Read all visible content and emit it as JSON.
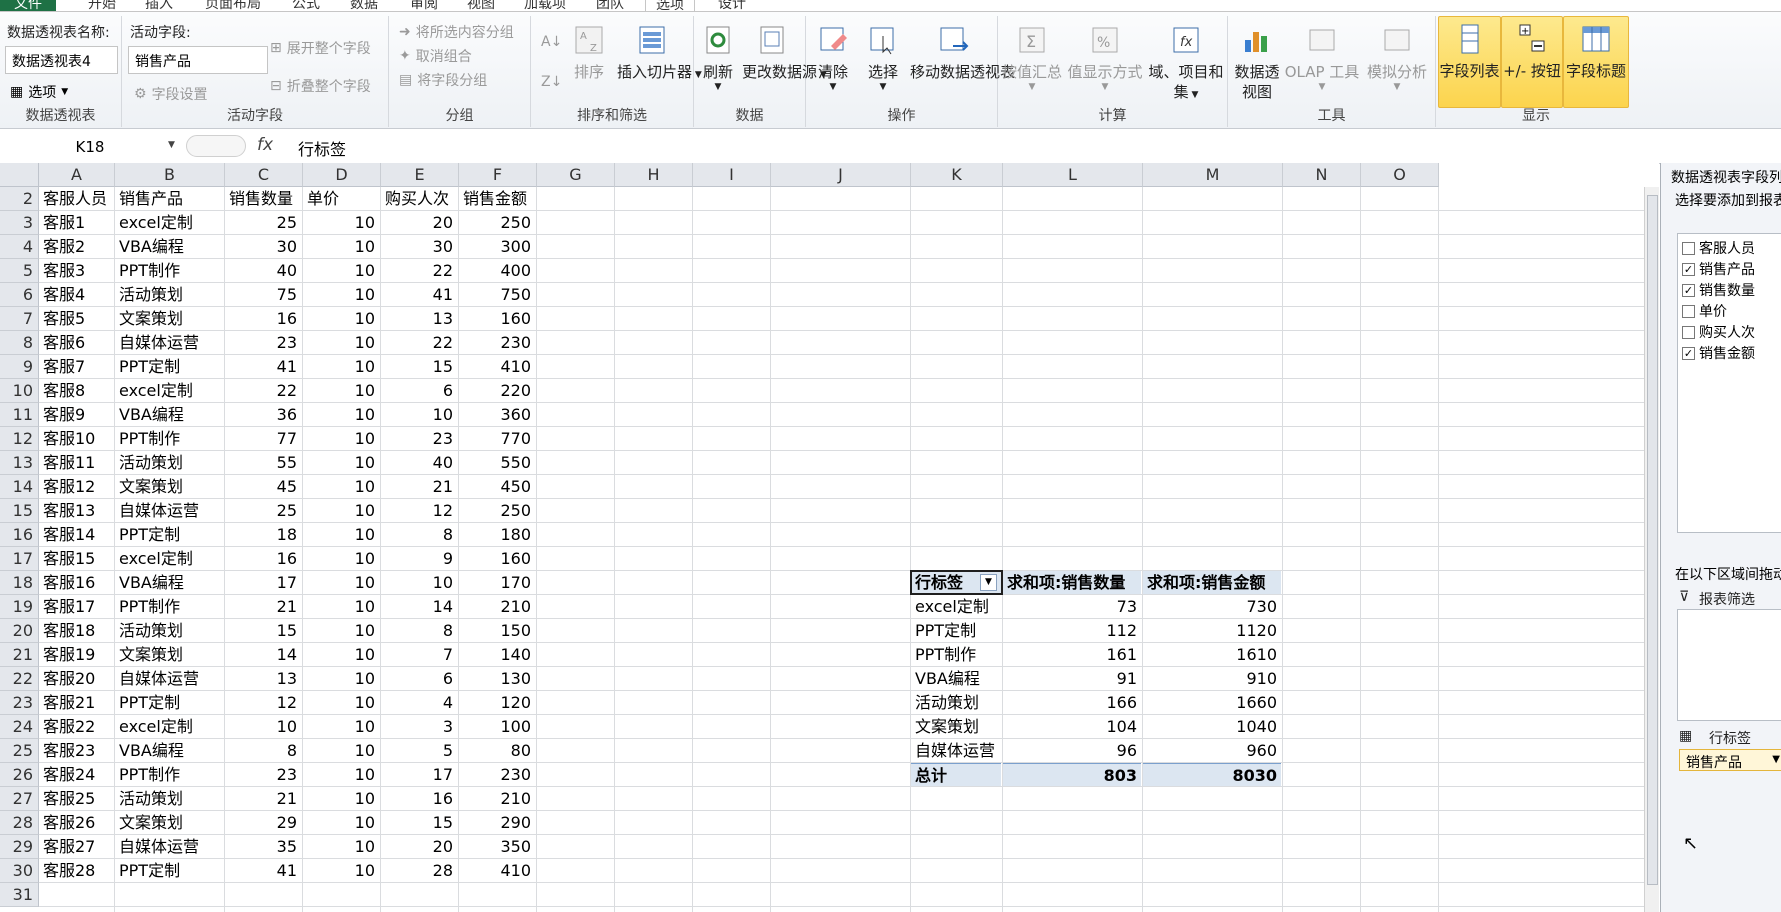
{
  "ribbon_tabs": [
    "文件",
    "开始",
    "插入",
    "页面布局",
    "公式",
    "数据",
    "审阅",
    "视图",
    "加载项",
    "团队",
    "选项",
    "设计"
  ],
  "ribbon": {
    "pivot_name_label": "数据透视表名称:",
    "pivot_name_value": "数据透视表4",
    "options_label": "选项",
    "group_pivot": "数据透视表",
    "active_field_label": "活动字段:",
    "active_field_value": "销售产品",
    "field_settings": "字段设置",
    "expand_field": "展开整个字段",
    "collapse_field": "折叠整个字段",
    "group_active_field": "活动字段",
    "group_selection": "将所选内容分组",
    "ungroup": "取消组合",
    "group_field": "将字段分组",
    "group_group": "分组",
    "sort": "排序",
    "insert_slicer": "插入切片器",
    "group_sort": "排序和筛选",
    "refresh": "刷新",
    "change_source": "更改数据源",
    "group_data": "数据",
    "clear": "清除",
    "select": "选择",
    "move_pivot": "移动数据透视表",
    "group_actions": "操作",
    "summarize_by": "按值汇总",
    "show_values_as": "值显示方式",
    "fields_items_sets": "域、项目和集",
    "group_calc": "计算",
    "pivot_chart": "数据透视图",
    "olap_tools": "OLAP 工具",
    "what_if": "模拟分析",
    "group_tools": "工具",
    "field_list": "字段列表",
    "plus_minus_buttons": "+/- 按钮",
    "field_headers": "字段标题",
    "group_show": "显示"
  },
  "formula_bar": {
    "name_box": "K18",
    "fx": "fx",
    "formula": "行标签"
  },
  "sheet": {
    "columns": [
      "A",
      "B",
      "C",
      "D",
      "E",
      "F",
      "G",
      "H",
      "I",
      "J",
      "K",
      "L",
      "M",
      "N",
      "O"
    ],
    "row_numbers": [
      "2",
      "3",
      "4",
      "5",
      "6",
      "7",
      "8",
      "9",
      "10",
      "11",
      "12",
      "13",
      "14",
      "15",
      "16",
      "17",
      "18",
      "19",
      "20",
      "21",
      "22",
      "23",
      "24",
      "25",
      "26",
      "27",
      "28",
      "29",
      "30",
      "31"
    ],
    "headers": [
      "客服人员",
      "销售产品",
      "销售数量",
      "单价",
      "购买人次",
      "销售金额"
    ],
    "rows": [
      [
        "客服1",
        "excel定制",
        "25",
        "10",
        "20",
        "250"
      ],
      [
        "客服2",
        "VBA编程",
        "30",
        "10",
        "30",
        "300"
      ],
      [
        "客服3",
        "PPT制作",
        "40",
        "10",
        "22",
        "400"
      ],
      [
        "客服4",
        "活动策划",
        "75",
        "10",
        "41",
        "750"
      ],
      [
        "客服5",
        "文案策划",
        "16",
        "10",
        "13",
        "160"
      ],
      [
        "客服6",
        "自媒体运营",
        "23",
        "10",
        "22",
        "230"
      ],
      [
        "客服7",
        "PPT定制",
        "41",
        "10",
        "15",
        "410"
      ],
      [
        "客服8",
        "excel定制",
        "22",
        "10",
        "6",
        "220"
      ],
      [
        "客服9",
        "VBA编程",
        "36",
        "10",
        "10",
        "360"
      ],
      [
        "客服10",
        "PPT制作",
        "77",
        "10",
        "23",
        "770"
      ],
      [
        "客服11",
        "活动策划",
        "55",
        "10",
        "40",
        "550"
      ],
      [
        "客服12",
        "文案策划",
        "45",
        "10",
        "21",
        "450"
      ],
      [
        "客服13",
        "自媒体运营",
        "25",
        "10",
        "12",
        "250"
      ],
      [
        "客服14",
        "PPT定制",
        "18",
        "10",
        "8",
        "180"
      ],
      [
        "客服15",
        "excel定制",
        "16",
        "10",
        "9",
        "160"
      ],
      [
        "客服16",
        "VBA编程",
        "17",
        "10",
        "10",
        "170"
      ],
      [
        "客服17",
        "PPT制作",
        "21",
        "10",
        "14",
        "210"
      ],
      [
        "客服18",
        "活动策划",
        "15",
        "10",
        "8",
        "150"
      ],
      [
        "客服19",
        "文案策划",
        "14",
        "10",
        "7",
        "140"
      ],
      [
        "客服20",
        "自媒体运营",
        "13",
        "10",
        "6",
        "130"
      ],
      [
        "客服21",
        "PPT定制",
        "12",
        "10",
        "4",
        "120"
      ],
      [
        "客服22",
        "excel定制",
        "10",
        "10",
        "3",
        "100"
      ],
      [
        "客服23",
        "VBA编程",
        "8",
        "10",
        "5",
        "80"
      ],
      [
        "客服24",
        "PPT制作",
        "23",
        "10",
        "17",
        "230"
      ],
      [
        "客服25",
        "活动策划",
        "21",
        "10",
        "16",
        "210"
      ],
      [
        "客服26",
        "文案策划",
        "29",
        "10",
        "15",
        "290"
      ],
      [
        "客服27",
        "自媒体运营",
        "35",
        "10",
        "20",
        "350"
      ],
      [
        "客服28",
        "PPT定制",
        "41",
        "10",
        "28",
        "410"
      ]
    ]
  },
  "pivot": {
    "headers": [
      "行标签",
      "求和项:销售数量",
      "求和项:销售金额"
    ],
    "rows": [
      [
        "excel定制",
        "73",
        "730"
      ],
      [
        "PPT定制",
        "112",
        "1120"
      ],
      [
        "PPT制作",
        "161",
        "1610"
      ],
      [
        "VBA编程",
        "91",
        "910"
      ],
      [
        "活动策划",
        "166",
        "1660"
      ],
      [
        "文案策划",
        "104",
        "1040"
      ],
      [
        "自媒体运营",
        "96",
        "960"
      ]
    ],
    "total": [
      "总计",
      "803",
      "8030"
    ]
  },
  "field_pane": {
    "title": "数据透视表字段列表",
    "subtitle": "选择要添加到报表的字段:",
    "fields": [
      {
        "name": "客服人员",
        "checked": false
      },
      {
        "name": "销售产品",
        "checked": true
      },
      {
        "name": "销售数量",
        "checked": true
      },
      {
        "name": "单价",
        "checked": false
      },
      {
        "name": "购买人次",
        "checked": false
      },
      {
        "name": "销售金额",
        "checked": true
      }
    ],
    "drag_hint": "在以下区域间拖动字段:",
    "report_filter": "报表筛选",
    "row_labels": "行标签",
    "row_chip": "销售产品"
  }
}
